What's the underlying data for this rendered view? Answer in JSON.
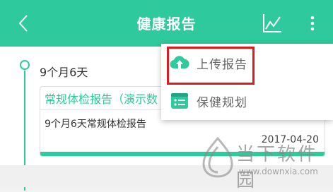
{
  "header": {
    "title": "健康报告",
    "back_icon": "back-chevron-icon",
    "chart_icon": "trend-chart-icon",
    "more_icon": "more-vertical-icon",
    "bg_color": "#2ec99c"
  },
  "timeline": {
    "age_label": "9个月6天",
    "card": {
      "title": "常规体检报告（演示数",
      "description": "9个月6天常规体检报告",
      "date": "2017-04-20"
    }
  },
  "menu": {
    "items": [
      {
        "label": "上传报告",
        "icon": "cloud-upload-icon"
      },
      {
        "label": "保健规划",
        "icon": "health-plan-icon"
      }
    ],
    "highlight_color": "#e0191f"
  },
  "watermark": {
    "text": "当下软件园",
    "url": "www.downxia.com"
  }
}
